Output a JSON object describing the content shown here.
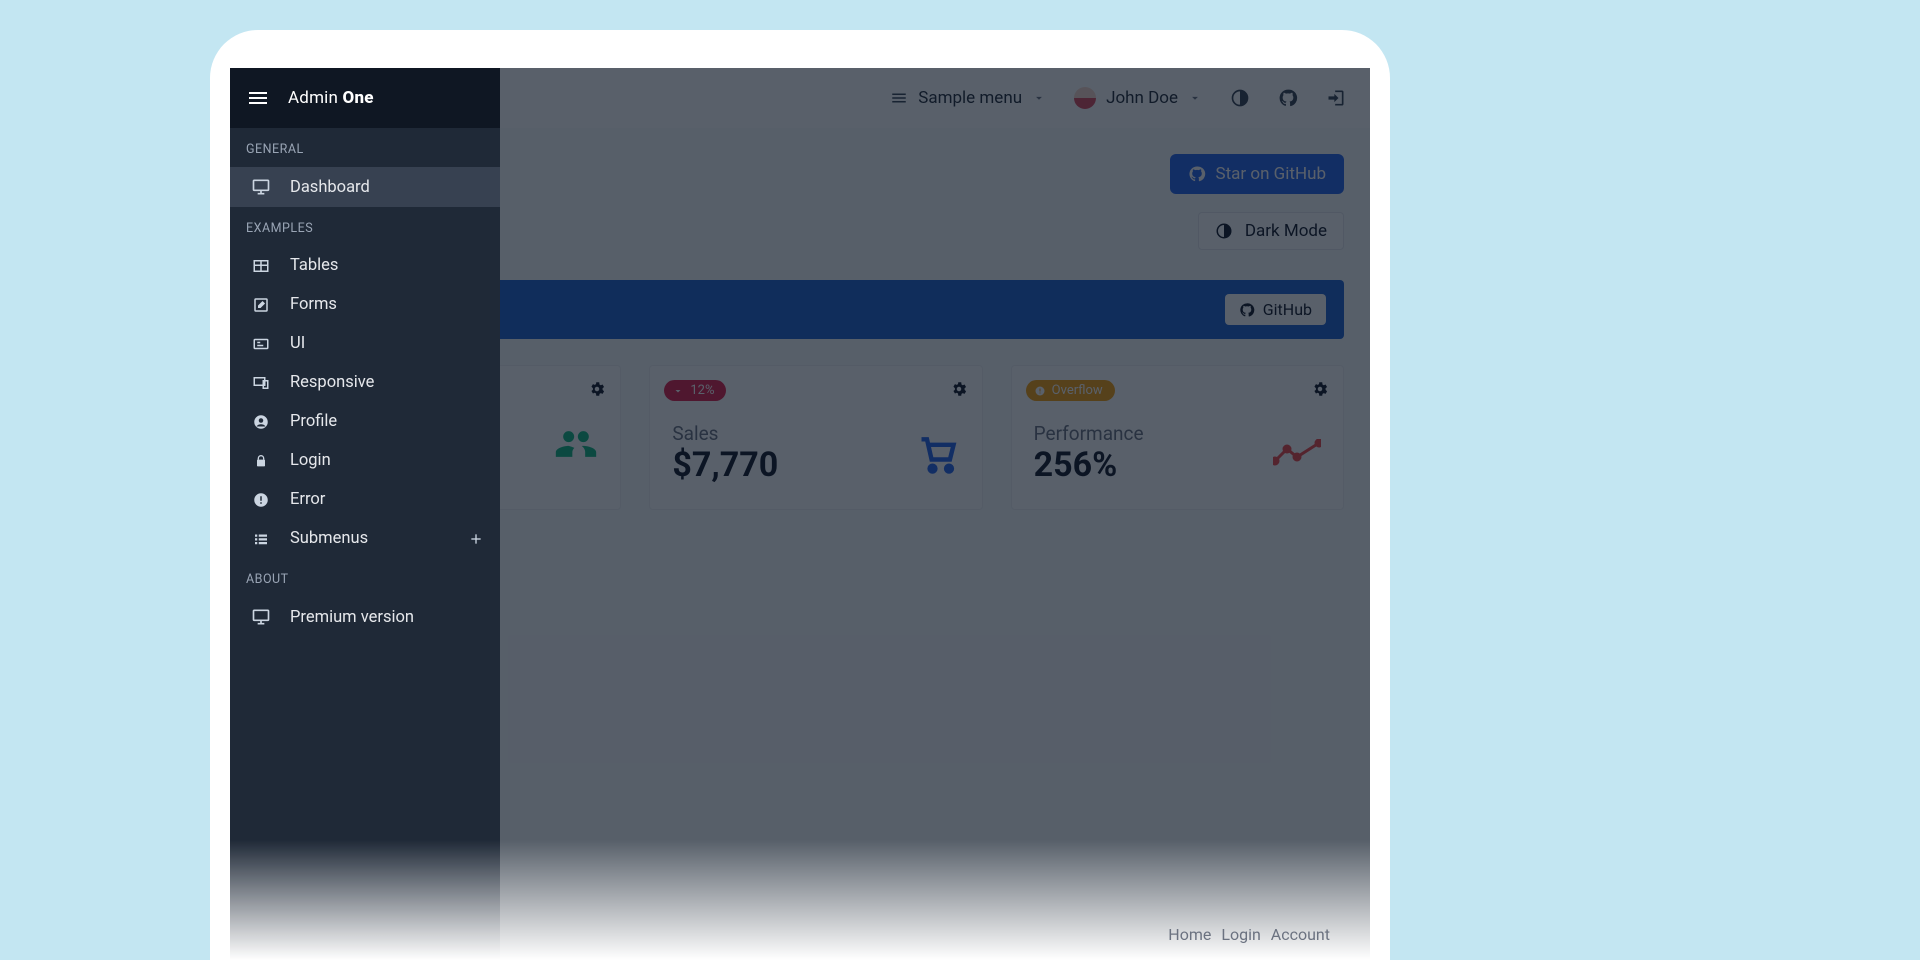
{
  "brand": {
    "first": "Admin",
    "second": "One"
  },
  "sidebar": {
    "sections": {
      "general": {
        "label": "GENERAL"
      },
      "examples": {
        "label": "EXAMPLES"
      },
      "about": {
        "label": "ABOUT"
      }
    },
    "items": {
      "dashboard": "Dashboard",
      "tables": "Tables",
      "forms": "Forms",
      "ui": "UI",
      "responsive": "Responsive",
      "profile": "Profile",
      "login": "Login",
      "error": "Error",
      "submenus": "Submenus",
      "premium": "Premium version"
    }
  },
  "topbar": {
    "sample_menu": "Sample menu",
    "user": "John Doe"
  },
  "header": {
    "github_btn": "Star on GitHub"
  },
  "dark_mode": {
    "label": "Dark Mode"
  },
  "banner": {
    "text_suffix": "GitHub",
    "button": "GitHub"
  },
  "cards": {
    "clients": {
      "pill": "",
      "label": "",
      "value": ""
    },
    "sales": {
      "pill": "12%",
      "label": "Sales",
      "value": "$7,770"
    },
    "perf": {
      "pill": "Overflow",
      "label": "Performance",
      "value": "256%"
    }
  },
  "footer": {
    "a": "Home",
    "b": "Login",
    "c": "Account"
  }
}
